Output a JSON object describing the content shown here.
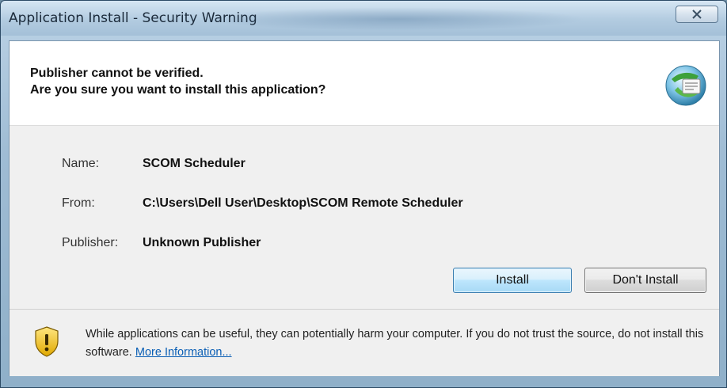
{
  "window": {
    "title": "Application Install - Security Warning"
  },
  "header": {
    "line1": "Publisher cannot be verified.",
    "line2": "Are you sure you want to install this application?",
    "icon": "clickonce-globe-icon"
  },
  "details": {
    "name_label": "Name:",
    "name_value": "SCOM Scheduler",
    "from_label": "From:",
    "from_value": "C:\\Users\\Dell User\\Desktop\\SCOM Remote Scheduler",
    "publisher_label": "Publisher:",
    "publisher_value": "Unknown Publisher"
  },
  "buttons": {
    "install": "Install",
    "dont_install": "Don't Install"
  },
  "footer": {
    "warning_text": "While applications can be useful, they can potentially harm your computer. If you do not trust the source, do not install this software.",
    "link": "More Information...",
    "icon": "security-shield-warning-icon"
  },
  "colors": {
    "link": "#0b5fb5",
    "install_border": "#3c7fb1",
    "shield_yellow": "#f2c21b"
  }
}
